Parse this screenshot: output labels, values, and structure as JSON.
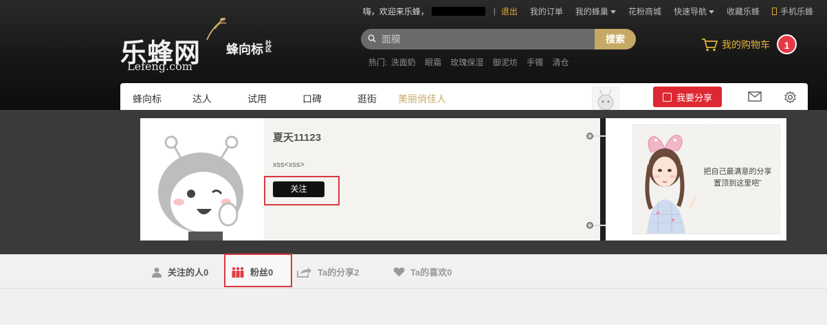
{
  "topbar": {
    "greeting": "嗨，欢迎来乐蜂，",
    "separator": "|",
    "logout": "退出",
    "my_orders": "我的订单",
    "my_hive": "我的蜂巢",
    "pollen_mall": "花粉商城",
    "quick_nav": "快速导航",
    "favorites": "收藏乐蜂",
    "mobile": "手机乐蜂"
  },
  "logo": {
    "cn": "乐蜂网",
    "en": "Lefeng.com",
    "sub": "蜂向标",
    "sub_small": "社区"
  },
  "search": {
    "placeholder": "面膜",
    "button": "搜索",
    "hot_label": "热门:",
    "hot_terms": [
      "洗面奶",
      "眼霜",
      "玫瑰保湿",
      "御泥坊",
      "手镯",
      "清仓"
    ]
  },
  "cart": {
    "label": "我的购物车",
    "count": "1"
  },
  "nav": {
    "tabs": [
      "蜂向标",
      "达人",
      "试用",
      "口碑",
      "逛街",
      "美丽俏佳人"
    ],
    "active_index": 5,
    "share_button": "我要分享"
  },
  "profile": {
    "username": "夏天11123",
    "intro": "xss<xss>",
    "follow_button": "关注"
  },
  "side": {
    "hint_line1": "把自己最满意的分享",
    "hint_line2": "置顶到这里吧˜"
  },
  "tabs": [
    {
      "label": "关注的人0",
      "icon": "person-icon"
    },
    {
      "label": "粉丝0",
      "icon": "group-icon"
    },
    {
      "label": "Ta的分享2",
      "icon": "share-arrow-icon"
    },
    {
      "label": "Ta的喜欢0",
      "icon": "heart-icon"
    }
  ],
  "colors": {
    "accent_gold": "#c7a966",
    "topbar_gold": "#e2b33a",
    "share_red": "#dd2833",
    "badge_red": "#e53a45",
    "highlight_red": "#d9363e"
  }
}
